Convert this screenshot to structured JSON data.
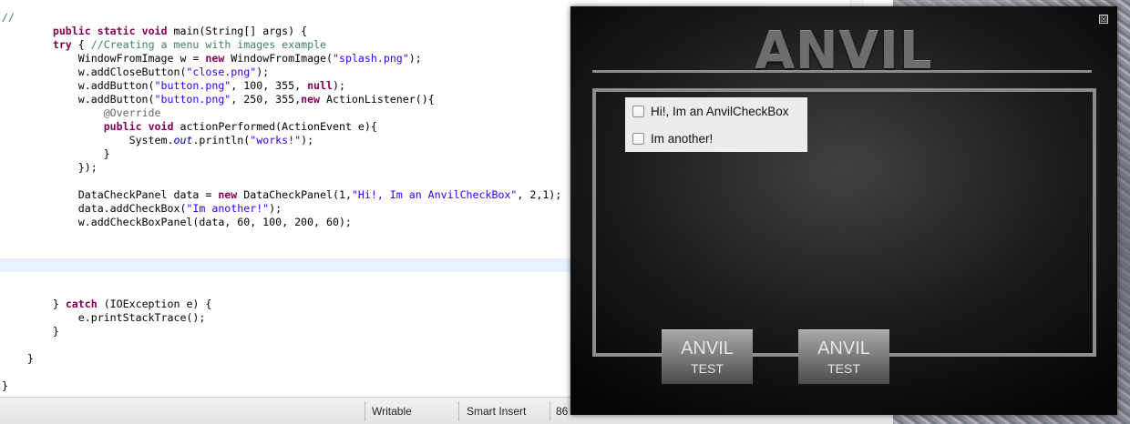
{
  "editor": {
    "lines": [
      {
        "segments": [
          {
            "t": "//",
            "c": "cm"
          }
        ]
      },
      {
        "segments": [
          {
            "t": "        "
          },
          {
            "t": "public",
            "c": "kw"
          },
          {
            "t": " "
          },
          {
            "t": "static",
            "c": "kw"
          },
          {
            "t": " "
          },
          {
            "t": "void",
            "c": "kw"
          },
          {
            "t": " main(String[] args) {"
          }
        ]
      },
      {
        "segments": [
          {
            "t": "        "
          },
          {
            "t": "try",
            "c": "kw"
          },
          {
            "t": " { "
          },
          {
            "t": "//Creating a menu with images example",
            "c": "cm"
          }
        ]
      },
      {
        "segments": [
          {
            "t": "            WindowFromImage w = "
          },
          {
            "t": "new",
            "c": "kw"
          },
          {
            "t": " WindowFromImage("
          },
          {
            "t": "\"splash.png\"",
            "c": "str"
          },
          {
            "t": ");"
          }
        ]
      },
      {
        "segments": [
          {
            "t": "            w.addCloseButton("
          },
          {
            "t": "\"close.png\"",
            "c": "str"
          },
          {
            "t": ");"
          }
        ]
      },
      {
        "segments": [
          {
            "t": "            w.addButton("
          },
          {
            "t": "\"button.png\"",
            "c": "str"
          },
          {
            "t": ", 100, 355, "
          },
          {
            "t": "null",
            "c": "kw"
          },
          {
            "t": ");"
          }
        ]
      },
      {
        "segments": [
          {
            "t": "            w.addButton("
          },
          {
            "t": "\"button.png\"",
            "c": "str"
          },
          {
            "t": ", 250, 355,"
          },
          {
            "t": "new",
            "c": "kw"
          },
          {
            "t": " ActionListener(){"
          }
        ]
      },
      {
        "segments": [
          {
            "t": "                "
          },
          {
            "t": "@Override",
            "c": "ann"
          }
        ]
      },
      {
        "segments": [
          {
            "t": "                "
          },
          {
            "t": "public",
            "c": "kw"
          },
          {
            "t": " "
          },
          {
            "t": "void",
            "c": "kw"
          },
          {
            "t": " actionPerformed(ActionEvent e){"
          }
        ]
      },
      {
        "segments": [
          {
            "t": "                    System."
          },
          {
            "t": "out",
            "c": "fld"
          },
          {
            "t": ".println("
          },
          {
            "t": "\"works!\"",
            "c": "str"
          },
          {
            "t": ");"
          }
        ]
      },
      {
        "segments": [
          {
            "t": "                }"
          }
        ]
      },
      {
        "segments": [
          {
            "t": "            });"
          }
        ]
      },
      {
        "segments": []
      },
      {
        "segments": [
          {
            "t": "            DataCheckPanel data = "
          },
          {
            "t": "new",
            "c": "kw"
          },
          {
            "t": " DataCheckPanel(1,"
          },
          {
            "t": "\"Hi!, Im an AnvilCheckBox\"",
            "c": "str"
          },
          {
            "t": ", 2,1);"
          }
        ]
      },
      {
        "segments": [
          {
            "t": "            data.addCheckBox("
          },
          {
            "t": "\"Im another!\"",
            "c": "str"
          },
          {
            "t": ");"
          }
        ]
      },
      {
        "segments": [
          {
            "t": "            w.addCheckBoxPanel(data, 60, 100, 200, 60);"
          }
        ]
      },
      {
        "segments": []
      },
      {
        "segments": []
      },
      {
        "segments": []
      },
      {
        "segments": []
      },
      {
        "segments": []
      },
      {
        "segments": [
          {
            "t": "        } "
          },
          {
            "t": "catch",
            "c": "kw"
          },
          {
            "t": " (IOException e) {"
          }
        ]
      },
      {
        "segments": [
          {
            "t": "            e.printStackTrace();"
          }
        ]
      },
      {
        "segments": [
          {
            "t": "        }"
          }
        ]
      },
      {
        "segments": []
      },
      {
        "segments": [
          {
            "t": "    }"
          }
        ]
      },
      {
        "segments": []
      },
      {
        "segments": [
          {
            "t": "}"
          }
        ]
      }
    ]
  },
  "statusbar": {
    "writable": "Writable",
    "insert_mode": "Smart Insert",
    "position": "86"
  },
  "anvil": {
    "title": "ANVIL",
    "close_glyph": "☒",
    "checkboxes": [
      {
        "label": "Hi!, Im an AnvilCheckBox",
        "checked": false
      },
      {
        "label": "Im another!",
        "checked": false
      }
    ],
    "buttons": [
      {
        "main": "ANVIL",
        "sub": "TEST"
      },
      {
        "main": "ANVIL",
        "sub": "TEST"
      }
    ]
  }
}
